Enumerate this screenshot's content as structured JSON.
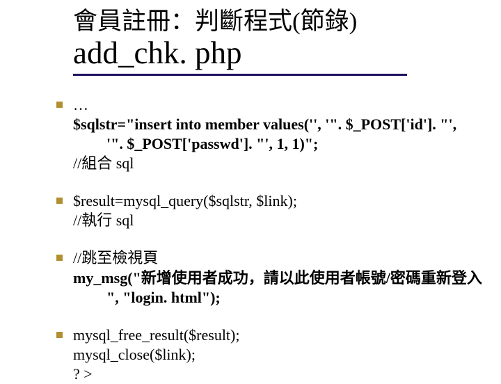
{
  "title": {
    "line1": "會員註冊：判斷程式(節錄)",
    "line2": "add_chk. php"
  },
  "body": {
    "ellipsis": "…",
    "sql_assign_l1": "$sqlstr=\"insert into member values('', '\". $_POST['id']. \"',",
    "sql_assign_l2": "'\". $_POST['passwd']. \"', 1, 1)\";",
    "sql_comment": "//組合 sql",
    "result_line": "$result=mysql_query($sqlstr, $link);",
    "result_comment": "//執行 sql",
    "jump_comment": "//跳至檢視頁",
    "mymsg_l1": "my_msg(\"新增使用者成功，請以此使用者帳號/密碼重新登入",
    "mymsg_l2": "\", \"login. html\");",
    "free_line": "mysql_free_result($result);",
    "close_line": "mysql_close($link);",
    "end_tag": "? >"
  }
}
